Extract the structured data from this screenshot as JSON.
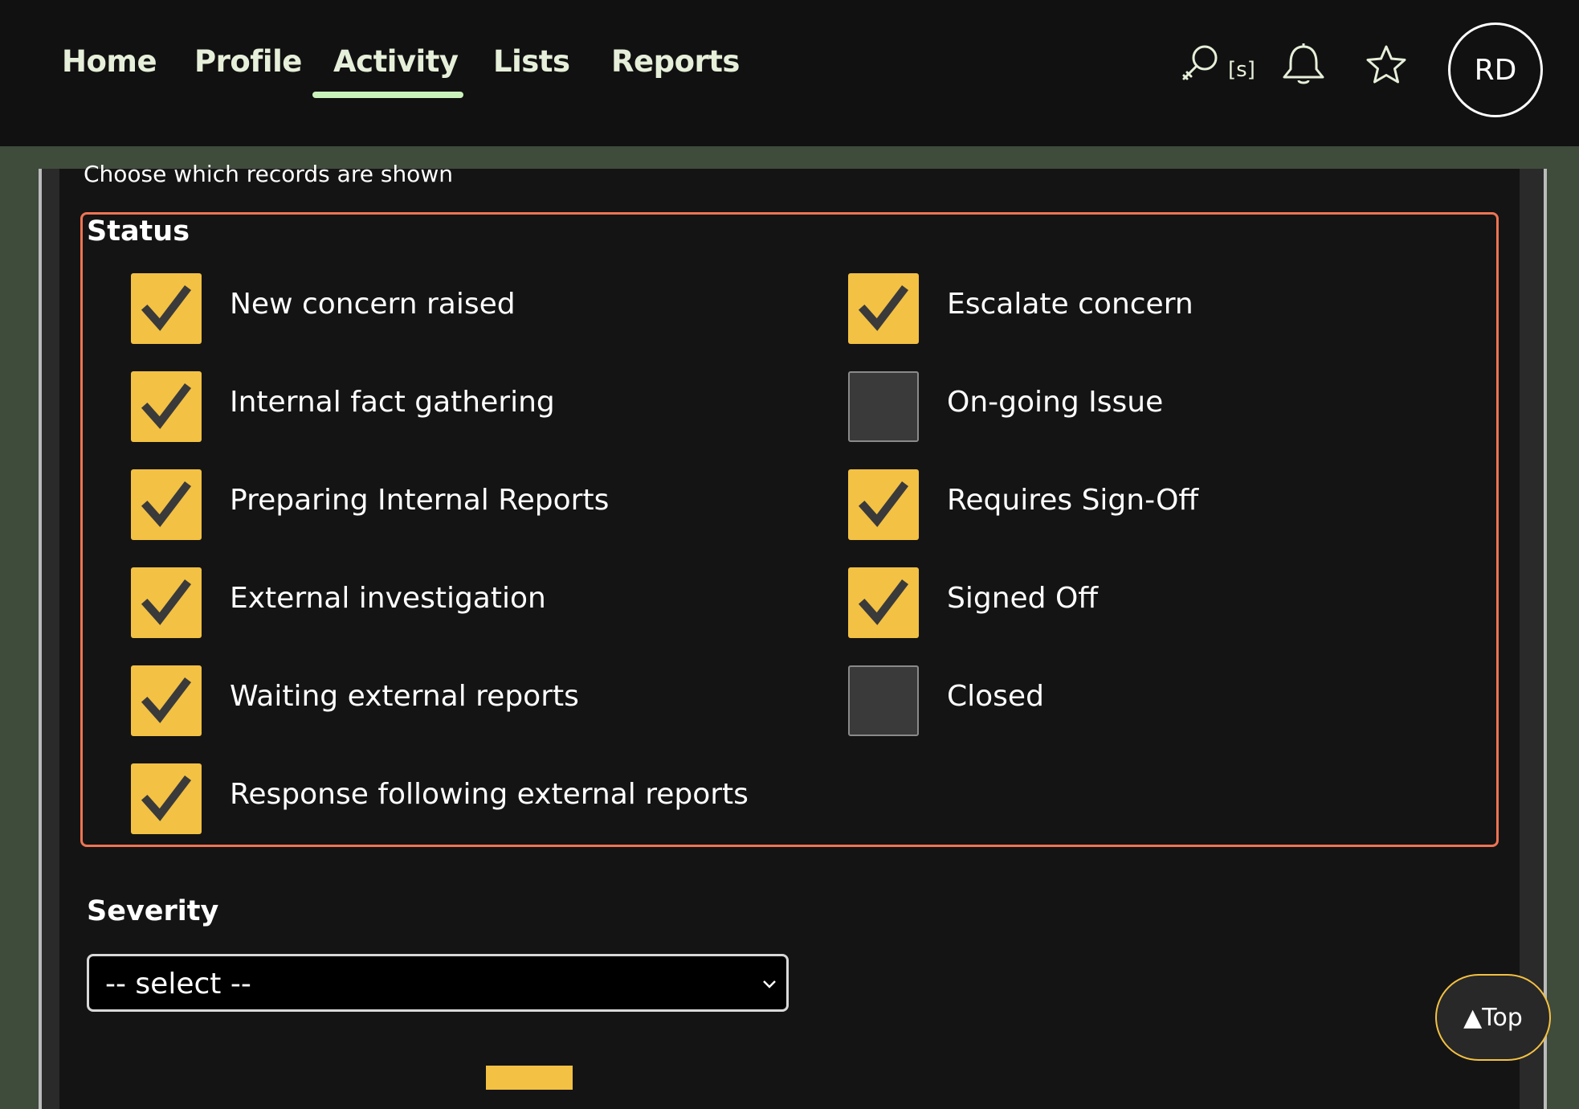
{
  "nav": {
    "tabs": [
      {
        "label": "Home",
        "active": false
      },
      {
        "label": "Profile",
        "active": false
      },
      {
        "label": "Activity",
        "active": true
      },
      {
        "label": "Lists",
        "active": false
      },
      {
        "label": "Reports",
        "active": false
      }
    ],
    "search_shortcut": "[s]",
    "icons": [
      "search-icon",
      "bell-icon",
      "star-icon"
    ],
    "avatar_initials": "RD"
  },
  "filter": {
    "hint": "Choose which records are shown",
    "status": {
      "legend": "Status",
      "options": [
        {
          "label": "New concern raised",
          "checked": true
        },
        {
          "label": "Internal fact gathering",
          "checked": true
        },
        {
          "label": "Preparing Internal Reports",
          "checked": true
        },
        {
          "label": "External investigation",
          "checked": true
        },
        {
          "label": "Waiting external reports",
          "checked": true
        },
        {
          "label": "Response following external reports",
          "checked": true
        },
        {
          "label": "Escalate concern",
          "checked": true
        },
        {
          "label": "On-going Issue",
          "checked": false
        },
        {
          "label": "Requires Sign-Off",
          "checked": true
        },
        {
          "label": "Signed Off",
          "checked": true
        },
        {
          "label": "Closed",
          "checked": false
        }
      ]
    },
    "severity": {
      "label": "Severity",
      "selected": "-- select --"
    }
  },
  "back_to_top": "▲Top",
  "colors": {
    "accent_border": "#ef7453",
    "checkbox_on": "#f3c143",
    "nav_underline": "#c9f2bb",
    "page_bg": "#3f4b3b"
  }
}
